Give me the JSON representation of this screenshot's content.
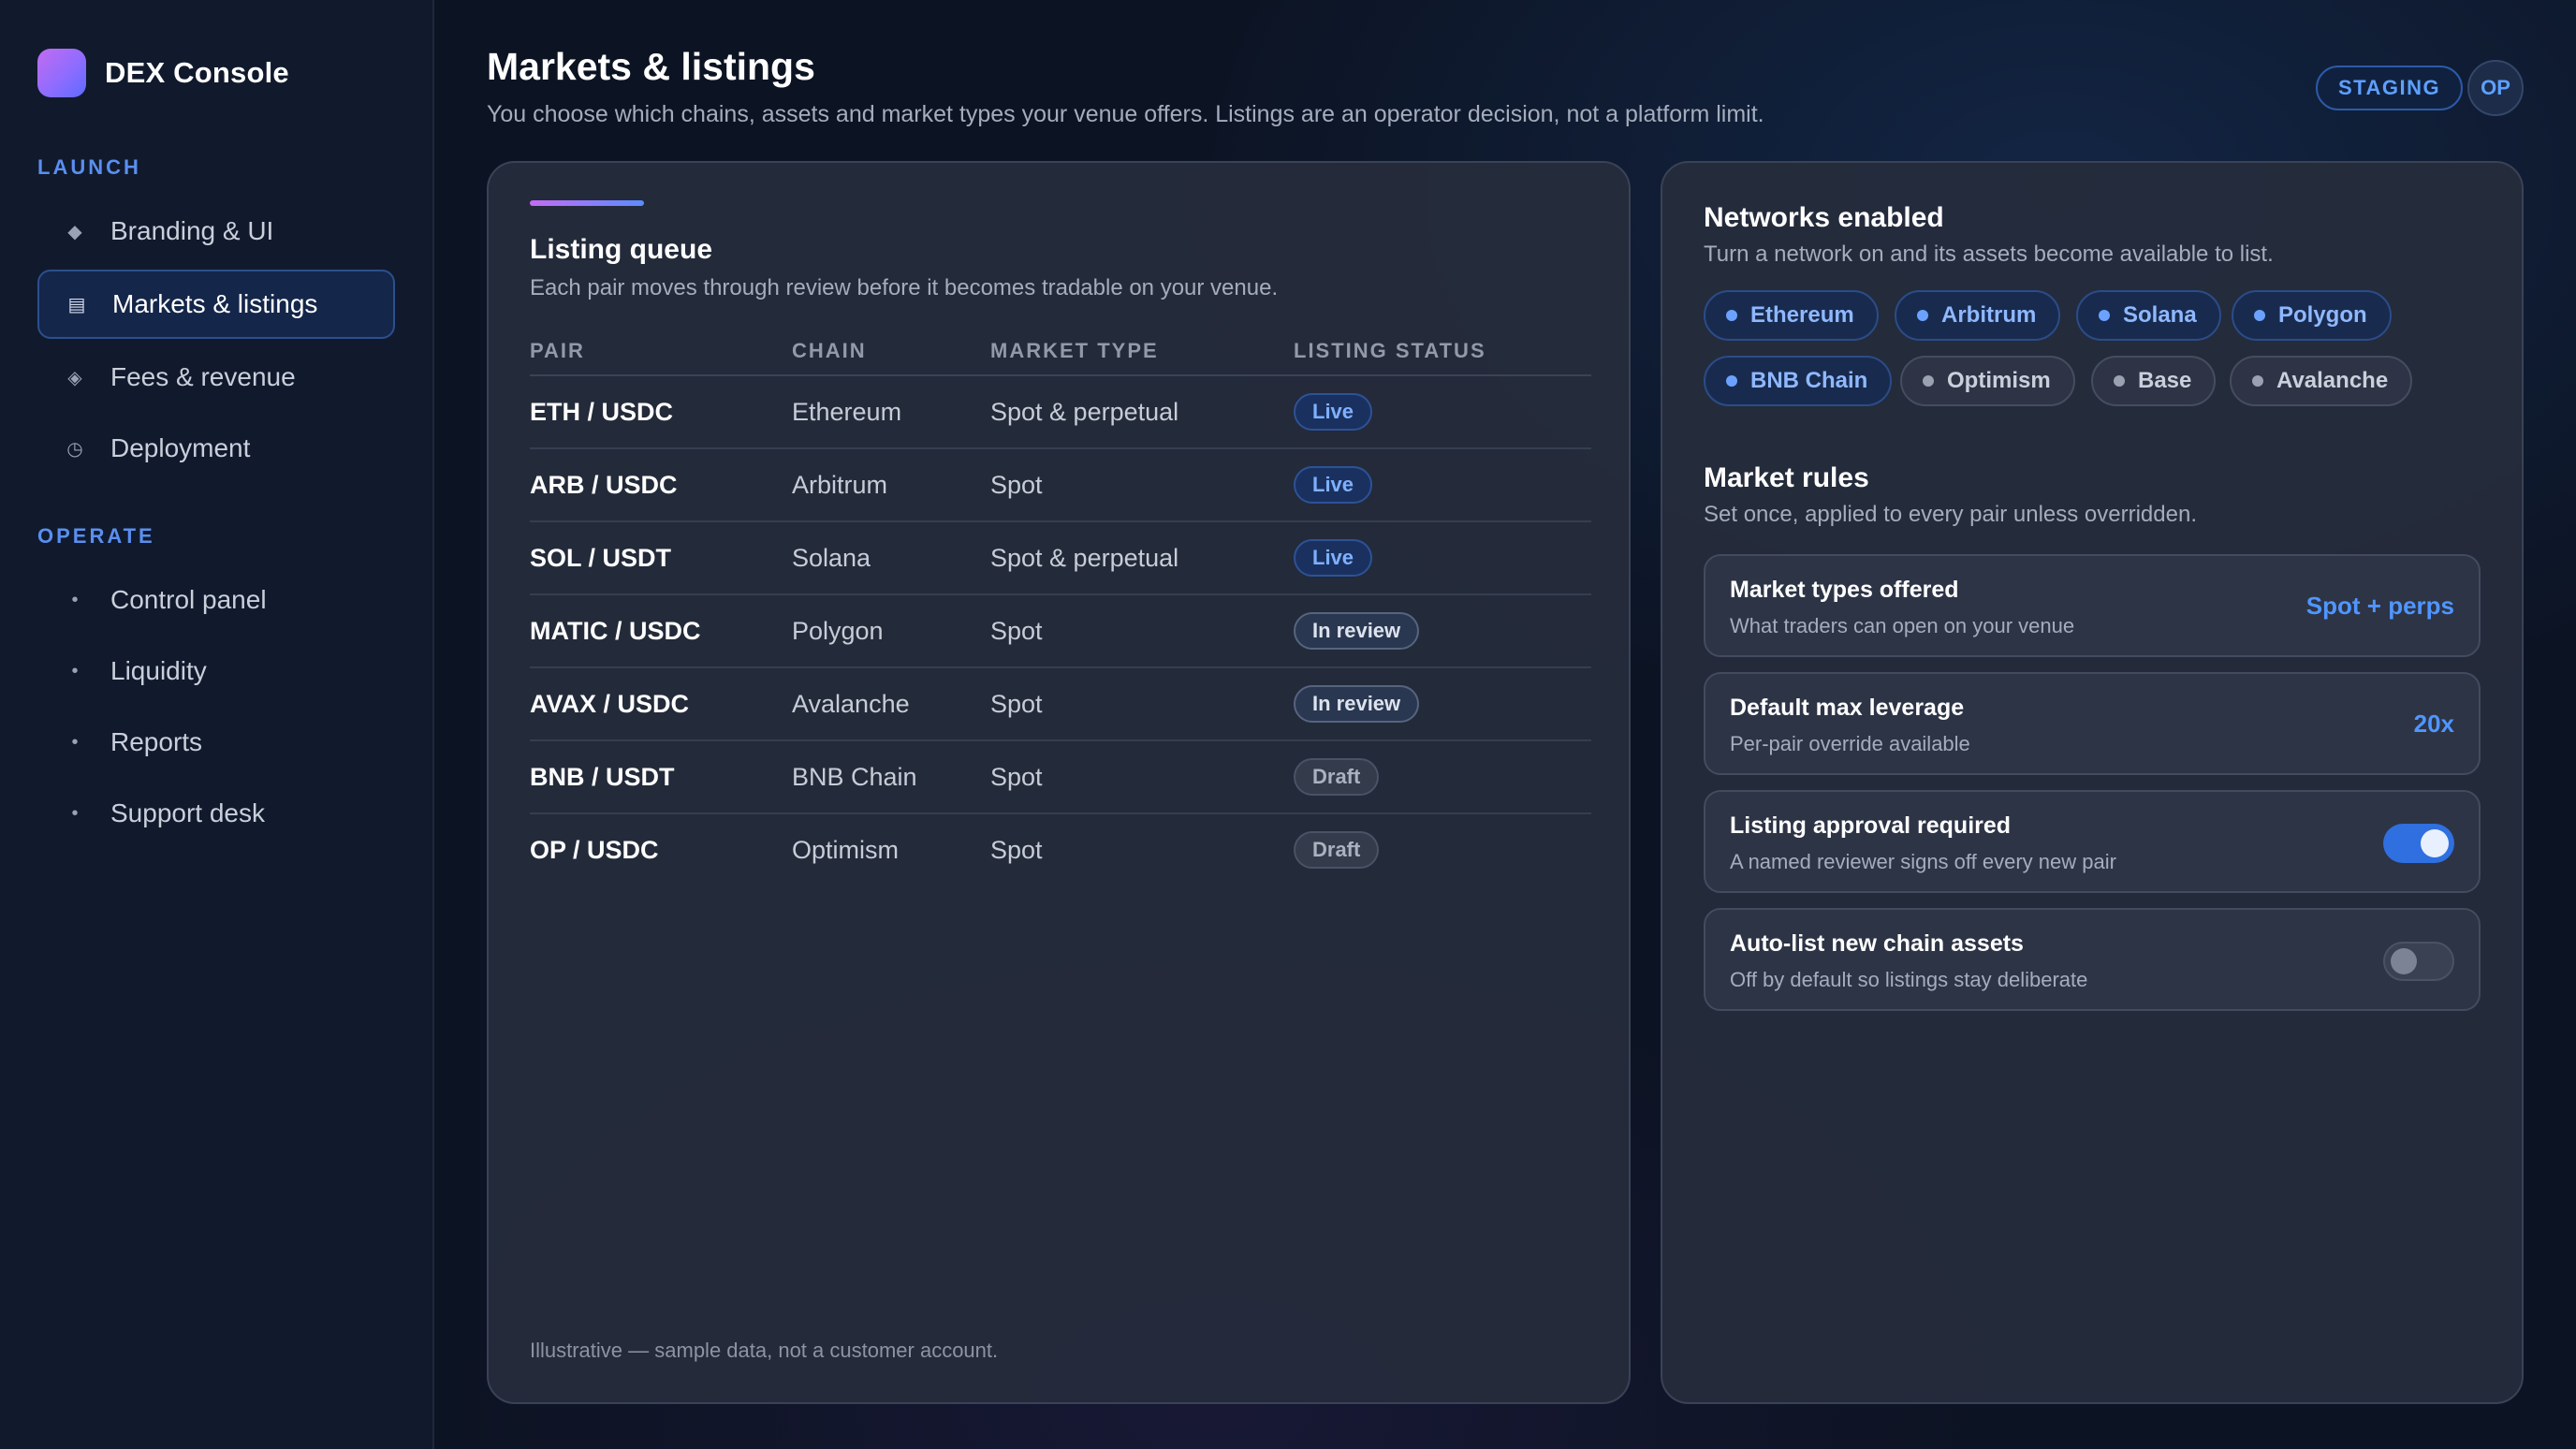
{
  "app": {
    "name": "DEX Console"
  },
  "sidebar": {
    "sections": [
      {
        "label": "LAUNCH",
        "items": [
          {
            "label": "Branding & UI",
            "icon": "diamond-icon",
            "glyph": "◆",
            "active": false
          },
          {
            "label": "Markets & listings",
            "icon": "list-icon",
            "glyph": "▤",
            "active": true
          },
          {
            "label": "Fees & revenue",
            "icon": "diamond-outline-icon",
            "glyph": "◈",
            "active": false
          },
          {
            "label": "Deployment",
            "icon": "clock-icon",
            "glyph": "◷",
            "active": false
          }
        ]
      },
      {
        "label": "OPERATE",
        "items": [
          {
            "label": "Control panel",
            "icon": "bullet-icon",
            "glyph": "•",
            "active": false
          },
          {
            "label": "Liquidity",
            "icon": "bullet-icon",
            "glyph": "•",
            "active": false
          },
          {
            "label": "Reports",
            "icon": "bullet-icon",
            "glyph": "•",
            "active": false
          },
          {
            "label": "Support desk",
            "icon": "bullet-icon",
            "glyph": "•",
            "active": false
          }
        ]
      }
    ]
  },
  "header": {
    "title": "Markets & listings",
    "subtitle": "You choose which chains, assets and market types your venue offers. Listings are an operator decision, not a platform limit.",
    "env_badge": "STAGING",
    "avatar_initials": "OP"
  },
  "queue": {
    "title": "Listing queue",
    "subtitle": "Each pair moves through review before it becomes tradable on your venue.",
    "columns": [
      "PAIR",
      "CHAIN",
      "MARKET TYPE",
      "LISTING STATUS"
    ],
    "rows": [
      {
        "pair": "ETH / USDC",
        "chain": "Ethereum",
        "market_type": "Spot & perpetual",
        "status": "Live",
        "status_kind": "live"
      },
      {
        "pair": "ARB / USDC",
        "chain": "Arbitrum",
        "market_type": "Spot",
        "status": "Live",
        "status_kind": "live"
      },
      {
        "pair": "SOL / USDT",
        "chain": "Solana",
        "market_type": "Spot & perpetual",
        "status": "Live",
        "status_kind": "live"
      },
      {
        "pair": "MATIC / USDC",
        "chain": "Polygon",
        "market_type": "Spot",
        "status": "In review",
        "status_kind": "review"
      },
      {
        "pair": "AVAX / USDC",
        "chain": "Avalanche",
        "market_type": "Spot",
        "status": "In review",
        "status_kind": "review"
      },
      {
        "pair": "BNB / USDT",
        "chain": "BNB Chain",
        "market_type": "Spot",
        "status": "Draft",
        "status_kind": "draft"
      },
      {
        "pair": "OP / USDC",
        "chain": "Optimism",
        "market_type": "Spot",
        "status": "Draft",
        "status_kind": "draft"
      }
    ],
    "footnote": "Illustrative — sample data, not a customer account."
  },
  "networks": {
    "title": "Networks enabled",
    "subtitle": "Turn a network on and its assets become available to list.",
    "chips": [
      {
        "label": "Ethereum",
        "enabled": true
      },
      {
        "label": "Arbitrum",
        "enabled": true
      },
      {
        "label": "Solana",
        "enabled": true
      },
      {
        "label": "Polygon",
        "enabled": true
      },
      {
        "label": "BNB Chain",
        "enabled": true
      },
      {
        "label": "Optimism",
        "enabled": false
      },
      {
        "label": "Base",
        "enabled": false
      },
      {
        "label": "Avalanche",
        "enabled": false
      }
    ]
  },
  "rules": {
    "title": "Market rules",
    "subtitle": "Set once, applied to every pair unless overridden.",
    "items": [
      {
        "title": "Market types offered",
        "sub": "What traders can open on your venue",
        "value": "Spot + perps"
      },
      {
        "title": "Default max leverage",
        "sub": "Per-pair override available",
        "value": "20x"
      },
      {
        "title": "Listing approval required",
        "sub": "A named reviewer signs off every new pair",
        "toggle": true
      },
      {
        "title": "Auto-list new chain assets",
        "sub": "Off by default so listings stay deliberate",
        "toggle": false
      }
    ]
  },
  "colors": {
    "accent": "#4f96ff",
    "live": "#7fb0ff",
    "toggle_on": "#2f6fe0"
  }
}
